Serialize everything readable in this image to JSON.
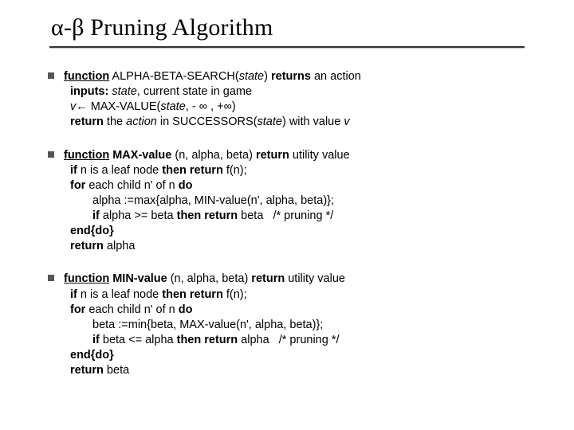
{
  "title": "α-β Pruning Algorithm",
  "block1": {
    "l1a": "function",
    "l1b": " ALPHA-BETA-SEARCH(",
    "l1c": "state",
    "l1d": ") ",
    "l1e": "returns",
    "l1f": " an action",
    "l2a": "inputs:",
    "l2b": " state",
    "l2c": ", current state in game",
    "l3a": "v",
    "l3b": "← MAX-VALUE(",
    "l3c": "state",
    "l3d": ", - ∞ , +∞)",
    "l4a": "return",
    "l4b": " the ",
    "l4c": "action",
    "l4d": " in SUCCESSORS(",
    "l4e": "state",
    "l4f": ") with value ",
    "l4g": "v"
  },
  "block2": {
    "l1a": "function",
    "l1b": " MAX-value",
    "l1c": " (n, alpha, beta) ",
    "l1d": "return",
    "l1e": " utility value",
    "l2a": "if",
    "l2b": " n is a leaf node ",
    "l2c": "then return",
    "l2d": " f(n);",
    "l3a": "for",
    "l3b": " each child n' of n ",
    "l3c": "do",
    "l4": "alpha :=max{alpha, MIN-value(n', alpha, beta)};",
    "l5a": "if",
    "l5b": " alpha >= beta ",
    "l5c": "then return",
    "l5d": " beta   /* pruning */",
    "l6": "end{do}",
    "l7a": "return",
    "l7b": " alpha"
  },
  "block3": {
    "l1a": "function",
    "l1b": " MIN-value",
    "l1c": " (n, alpha, beta) ",
    "l1d": "return",
    "l1e": " utility value",
    "l2a": "if",
    "l2b": " n is a leaf node ",
    "l2c": "then return",
    "l2d": " f(n);",
    "l3a": "for",
    "l3b": " each child n' of n ",
    "l3c": "do",
    "l4": "beta :=min{beta, MAX-value(n', alpha, beta)};",
    "l5a": "if",
    "l5b": " beta <= alpha ",
    "l5c": "then return",
    "l5d": " alpha   /* pruning */",
    "l6": "end{do}",
    "l7a": "return",
    "l7b": " beta"
  }
}
